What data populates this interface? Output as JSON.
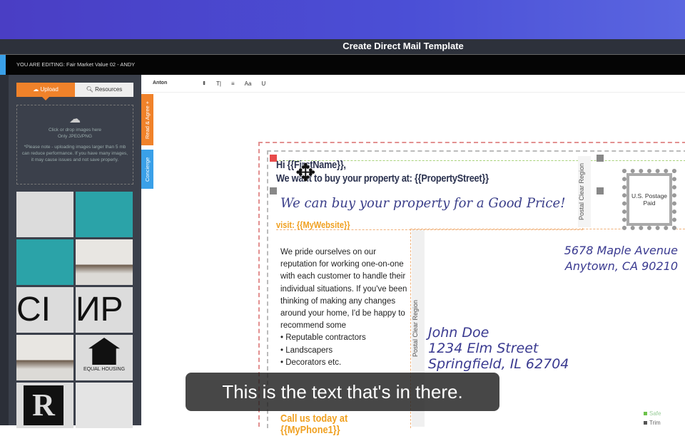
{
  "app": {
    "title": "Create Direct Mail Template",
    "editing": "YOU ARE EDITING: Fair Market Value 02 - ANDY"
  },
  "panel": {
    "upload_tab": "Upload",
    "resources_tab": "Resources",
    "drop_line1": "Click or drop images here",
    "drop_line2": "Only JPEG/PNG",
    "drop_note": "*Please note - uploading images larger than 5 mb can reduce performance. If you have many images, it may cause issues and not save properly.",
    "equal_housing": "EQUAL HOUSING",
    "cmp_left": "CI",
    "cmp_right": "ИP"
  },
  "toolbar": {
    "font": "Anton"
  },
  "side_tabs": {
    "read_agree": "Read & Agree +",
    "concierge": "Concierge"
  },
  "postcard": {
    "greeting": "Hi {{FirstName}},",
    "headline": "We want to buy your property at: {{PropertyStreet}}",
    "script_line": "We can buy your property for a Good Price!",
    "visit": "visit: {{MyWebsite}}",
    "body": [
      "We pride ourselves on our reputation for working one-on-one with each customer to handle their individual situations. If you've been thinking of making any changes around your home, I'd be happy to recommend some",
      "• Reputable contractors",
      "• Landscapers",
      "• Decorators etc."
    ],
    "call": "Call us today at",
    "phone": "{{MyPhone1}}",
    "postal_clear": "Postal Clear Region",
    "stamp": "U.S. Postage Paid",
    "return_address": [
      "5678 Maple Avenue",
      "Anytown, CA 90210"
    ],
    "recipient": [
      "John Doe",
      "1234 Elm Street",
      "Springfield, IL 62704"
    ],
    "legend": {
      "safe": "Safe",
      "trim": "Trim"
    }
  },
  "colors": {
    "accent": "#f0822a",
    "concierge": "#3aa0e8",
    "safe": "#6cc24a"
  },
  "subtitle": "This is the text that's in there."
}
